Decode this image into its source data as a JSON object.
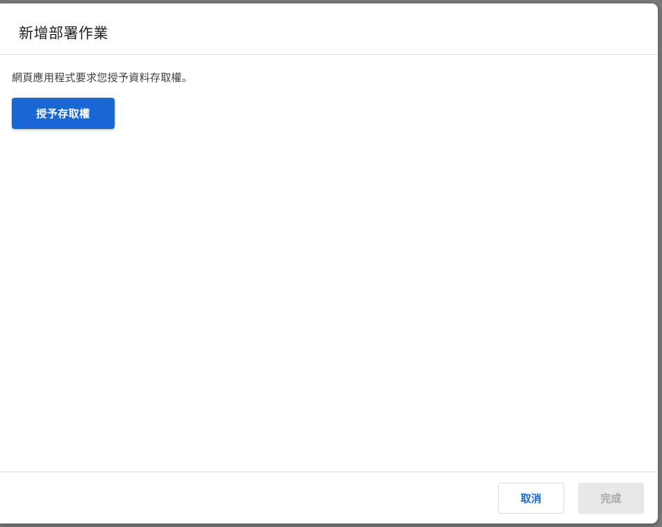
{
  "dialog": {
    "title": "新增部署作業",
    "message": "網頁應用程式要求您授予資料存取權。",
    "grant_button_label": "授予存取權",
    "footer": {
      "cancel_label": "取消",
      "done_label": "完成"
    }
  },
  "colors": {
    "primary": "#1967d2",
    "disabled_bg": "#e8e8e8",
    "disabled_text": "#a8a8a8",
    "divider": "#dadce0"
  }
}
